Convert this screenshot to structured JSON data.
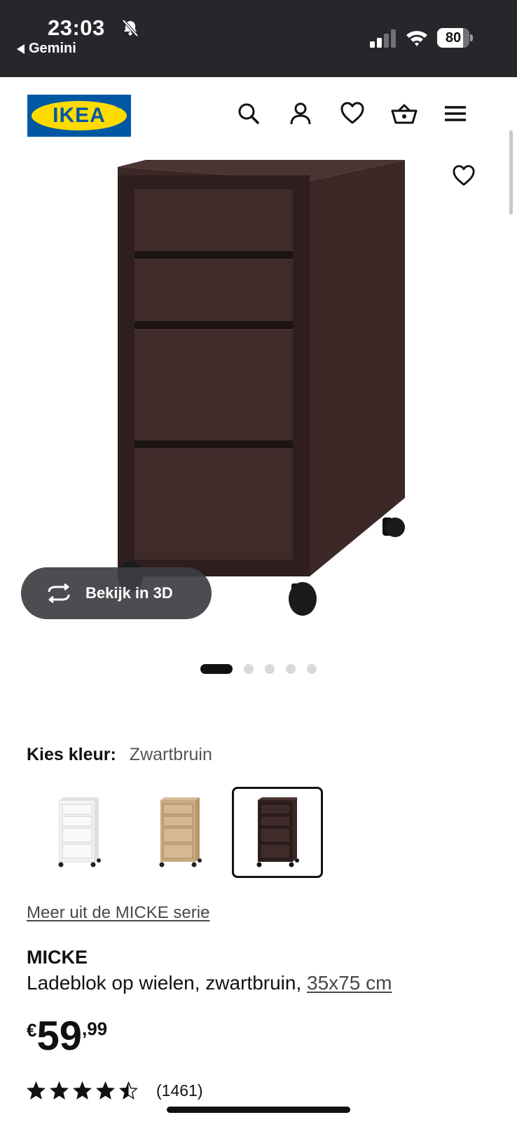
{
  "status_bar": {
    "time": "23:03",
    "back_app": "Gemini",
    "battery": "80",
    "battery_level": 0.8
  },
  "header": {
    "logo_text": "IKEA",
    "icons": [
      "search-icon",
      "account-icon",
      "heart-icon",
      "basket-icon",
      "menu-icon"
    ]
  },
  "gallery": {
    "view_3d_label": "Bekijk in 3D",
    "image_count": 5,
    "active_index": 0
  },
  "color_picker": {
    "label": "Kies kleur:",
    "selected_value": "Zwartbruin",
    "options": [
      {
        "name": "white",
        "color": "#f3f3f3"
      },
      {
        "name": "oak",
        "color": "#c9a882"
      },
      {
        "name": "black-brown",
        "color": "#3d2b2a"
      }
    ],
    "selected_index": 2
  },
  "series_link": "Meer uit de MICKE serie",
  "product": {
    "name": "MICKE",
    "description": "Ladeblok op wielen, zwartbruin,",
    "dimensions": "35x75 cm",
    "price": {
      "currency": "€",
      "integer": "59",
      "decimal": ",99"
    },
    "rating": {
      "value": 4.5,
      "max": 5,
      "count": "(1461)"
    }
  },
  "colors": {
    "status_bar_bg": "#25272b",
    "ikea_blue": "#0058a3",
    "ikea_yellow": "#ffdb00",
    "cabinet": "#3b2827"
  }
}
